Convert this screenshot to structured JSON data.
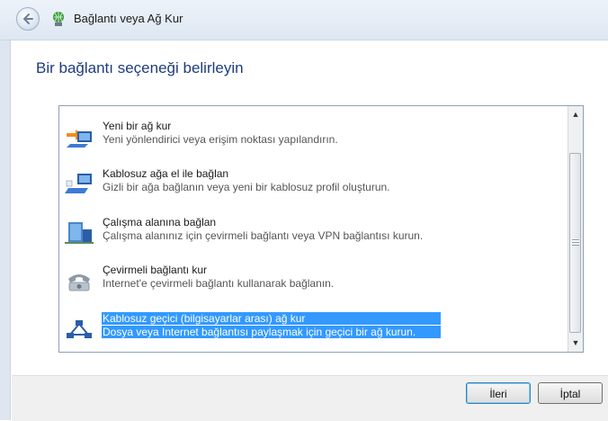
{
  "window": {
    "title": "Bağlantı veya Ağ Kur"
  },
  "heading": "Bir bağlantı seçeneği belirleyin",
  "options": [
    {
      "title": "Yeni bir ağ kur",
      "description": "Yeni yönlendirici veya erişim noktası yapılandırın.",
      "icon": "network-setup-icon",
      "selected": false
    },
    {
      "title": "Kablosuz ağa el ile bağlan",
      "description": "Gizli bir ağa bağlanın veya yeni bir kablosuz profil oluşturun.",
      "icon": "wireless-manual-icon",
      "selected": false
    },
    {
      "title": "Çalışma alanına bağlan",
      "description": "Çalışma alanınız için çevirmeli bağlantı veya VPN bağlantısı kurun.",
      "icon": "workplace-icon",
      "selected": false
    },
    {
      "title": "Çevirmeli bağlantı kur",
      "description": "Internet'e çevirmeli bağlantı kullanarak bağlanın.",
      "icon": "dialup-phone-icon",
      "selected": false
    },
    {
      "title": "Kablosuz geçici (bilgisayarlar arası) ağ kur",
      "description": "Dosya veya Internet bağlantısı paylaşmak için geçici bir ağ kurun.",
      "icon": "adhoc-network-icon",
      "selected": true
    }
  ],
  "buttons": {
    "next": "İleri",
    "cancel": "İptal"
  },
  "colors": {
    "selection": "#3399ff",
    "heading": "#1f3d7a"
  }
}
